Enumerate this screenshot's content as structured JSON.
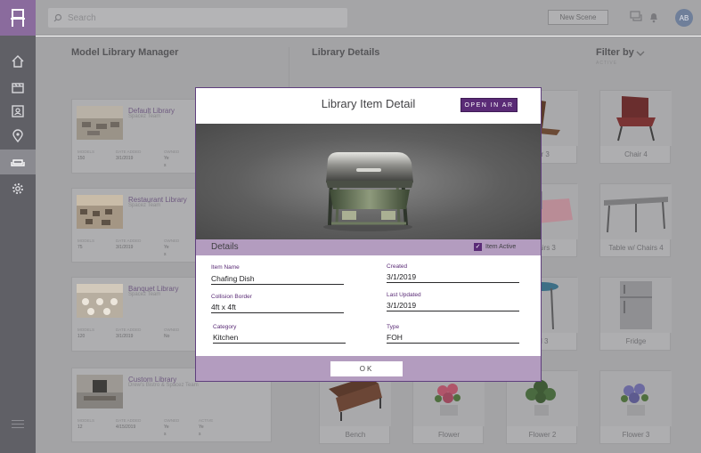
{
  "search": {
    "placeholder": "Search"
  },
  "header": {
    "new_scene_label": "New Scene",
    "avatar_initials": "AB"
  },
  "sections": {
    "model_library_manager": "Model Library Manager",
    "library_details": "Library Details",
    "filter_by": "Filter by",
    "filter_sub": "ACTIVE"
  },
  "libraries": [
    {
      "title": "Default Library",
      "subtitle": "Spacez Team",
      "meta": {
        "models_label": "MODELS",
        "date_label": "DATE ADDED",
        "owned_label": "OWNED"
      },
      "models": "150",
      "date": "3/1/2019",
      "owned": "Ye s"
    },
    {
      "title": "Restaurant Library",
      "subtitle": "Spacez Team",
      "meta": {
        "models_label": "MODELS",
        "date_label": "DATE ADDED",
        "owned_label": "OWNED"
      },
      "models": "75",
      "date": "3/1/2019",
      "owned": "Ye s"
    },
    {
      "title": "Banquet Library",
      "subtitle": "Spacez Team",
      "meta": {
        "models_label": "MODELS",
        "date_label": "DATE ADDED",
        "owned_label": "OWNED"
      },
      "models": "120",
      "date": "3/1/2019",
      "owned": "No"
    },
    {
      "title": "Custom Library",
      "subtitle": "Drew's Bistro & Spacez Team",
      "meta": {
        "models_label": "MODELS",
        "date_label": "DATE ADDED",
        "owned_label": "OWNED",
        "active_label": "ACTIVE"
      },
      "models": "12",
      "date": "4/15/2019",
      "owned": "Ye s",
      "active": "Ye s"
    }
  ],
  "items": [
    {
      "label": "air 3"
    },
    {
      "label": "Chair 4"
    },
    {
      "label": "Chairs 3"
    },
    {
      "label": "Table w/ Chairs 4"
    },
    {
      "label": "ol 3"
    },
    {
      "label": "Fridge"
    },
    {
      "label": "Bench"
    },
    {
      "label": "Flower"
    },
    {
      "label": "Flower 2"
    },
    {
      "label": "Flower 3"
    }
  ],
  "modal": {
    "title": "Library Item Detail",
    "open_ar_label": "OPEN IN AR",
    "details_label": "Details",
    "item_active_label": "Item Active",
    "item_active_checked": "✓",
    "fields": {
      "item_name": {
        "label": "Item Name",
        "value": "Chafing Dish"
      },
      "created": {
        "label": "Created",
        "value": "3/1/2019"
      },
      "collision_border": {
        "label": "Collision Border",
        "value": "4ft x 4ft"
      },
      "last_updated": {
        "label": "Last Updated",
        "value": "3/1/2019"
      },
      "category": {
        "label": "Category",
        "value": "Kitchen"
      },
      "type": {
        "label": "Type",
        "value": "FOH"
      }
    },
    "ok_label": "OK"
  },
  "colors": {
    "accent_purple": "#5a2b76",
    "modal_bar": "#b39cbf",
    "sidebar": "#606066",
    "logo_bg": "#8a6b9d"
  },
  "icons": {
    "sidebar": [
      "home-icon",
      "film-icon",
      "contacts-icon",
      "location-pin-icon",
      "sofa-icon",
      "gear-icon"
    ],
    "top": [
      "search-icon",
      "chat-icon",
      "bell-icon"
    ]
  }
}
